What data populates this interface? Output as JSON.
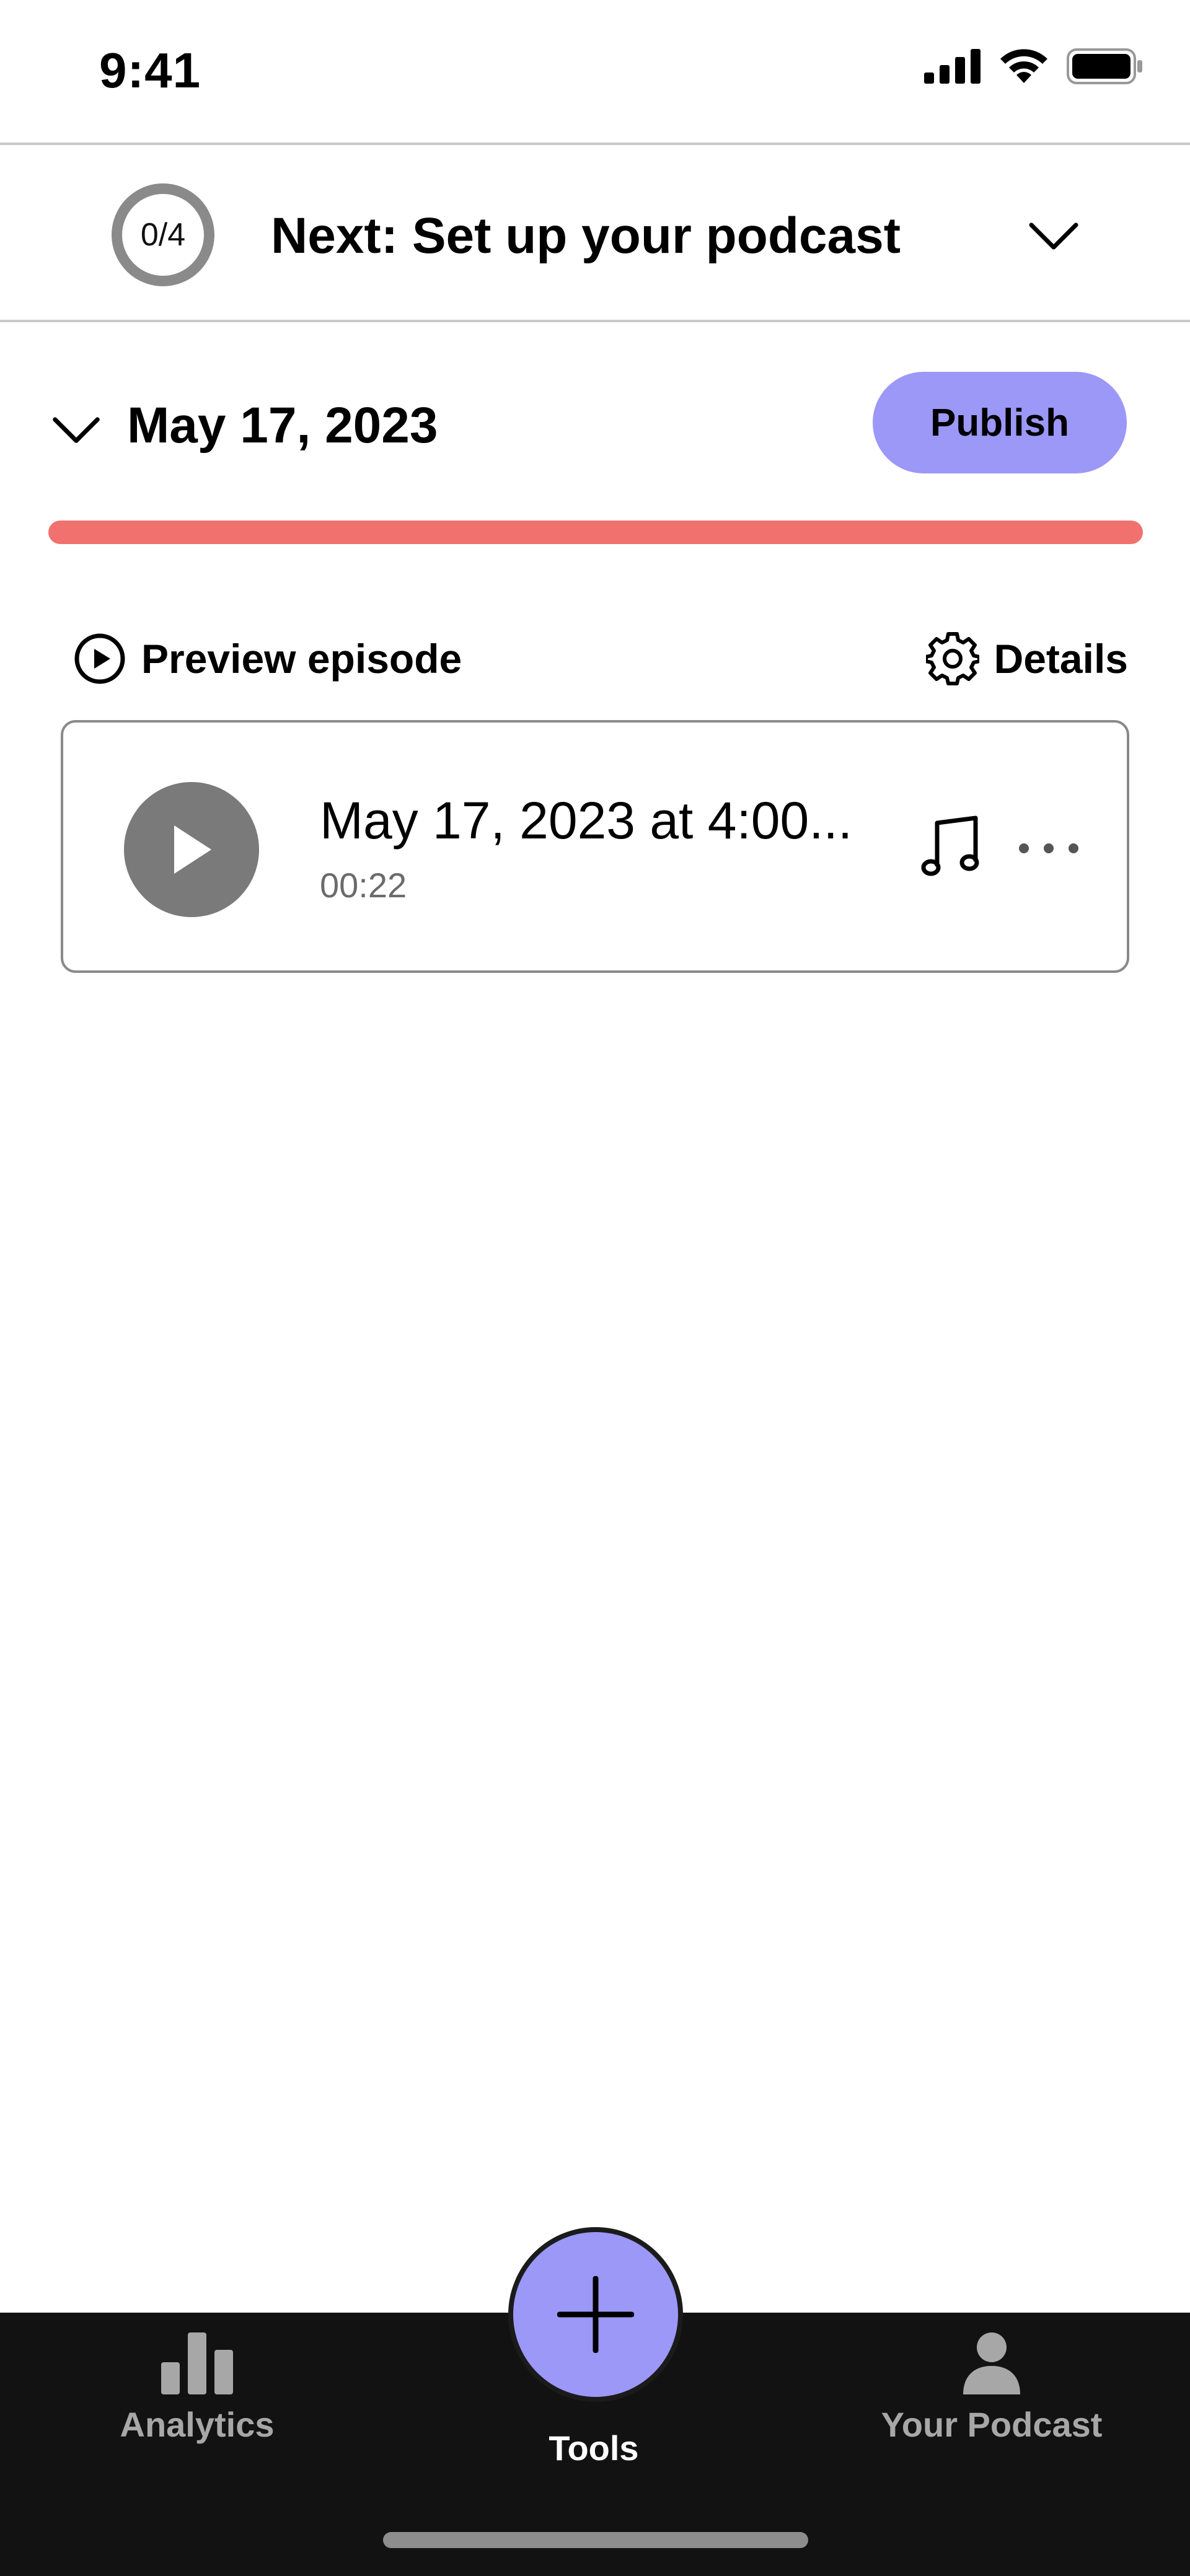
{
  "status_bar": {
    "time": "9:41",
    "icons": [
      "signal-icon",
      "wifi-icon",
      "battery-icon"
    ]
  },
  "next_step": {
    "progress_text": "0/4",
    "progress_fraction": 0,
    "label": "Next: Set up your podcast",
    "icon": "chevron-down-icon"
  },
  "episode": {
    "date": "May 17, 2023",
    "publish_label": "Publish",
    "progress_color": "#f0716e"
  },
  "actions": {
    "preview_label": "Preview episode",
    "details_label": "Details"
  },
  "audio_item": {
    "title": "May 17, 2023 at 4:00...",
    "duration": "00:22",
    "icons": [
      "play-icon",
      "music-note-icon",
      "more-icon"
    ]
  },
  "tab_bar": {
    "tabs": [
      {
        "label": "Analytics",
        "icon": "bar-chart-icon",
        "active": false
      },
      {
        "label": "Tools",
        "icon": "plus-icon",
        "active": true
      },
      {
        "label": "Your Podcast",
        "icon": "person-icon",
        "active": false
      }
    ]
  },
  "colors": {
    "accent": "#9b98f7",
    "progress_bar": "#f0716e",
    "tab_bar_bg": "#121212"
  }
}
